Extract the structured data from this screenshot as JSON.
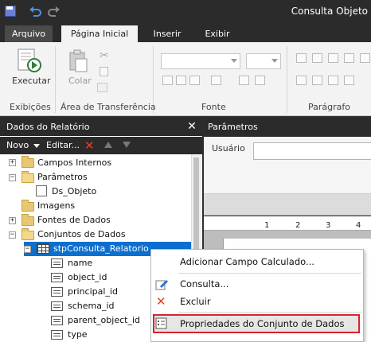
{
  "window": {
    "title": "Consulta Objeto"
  },
  "ribbon": {
    "tabs": [
      "Arquivo",
      "Página Inicial",
      "Inserir",
      "Exibir"
    ],
    "run_label": "Executar",
    "paste_label": "Colar",
    "groups": [
      "Exibições",
      "Área de Transferência",
      "Fonte",
      "Parágrafo"
    ]
  },
  "report_data": {
    "title": "Dados do Relatório",
    "toolbar": {
      "new_label": "Novo",
      "edit_label": "Editar..."
    },
    "tree": {
      "builtin_fields": "Campos Internos",
      "parameters": "Parâmetros",
      "param_item": "Ds_Objeto",
      "images": "Imagens",
      "data_sources": "Fontes de Dados",
      "datasets": "Conjuntos de Dados",
      "dataset_name": "stpConsulta_Relatorio",
      "fields": [
        "name",
        "object_id",
        "principal_id",
        "schema_id",
        "parent_object_id",
        "type"
      ]
    }
  },
  "parameters_pane": {
    "title": "Parâmetros",
    "user_label": "Usuário",
    "user_value": ""
  },
  "ruler": {
    "marks": [
      "1",
      "2",
      "3",
      "4"
    ]
  },
  "context_menu": {
    "items": [
      "Adicionar Campo Calculado...",
      "Consulta...",
      "Excluir",
      "Propriedades do Conjunto de Dados"
    ]
  },
  "colors": {
    "selection": "#0a6fcf",
    "highlight_border": "#d9232d",
    "dark_chrome": "#2b2b2b"
  }
}
